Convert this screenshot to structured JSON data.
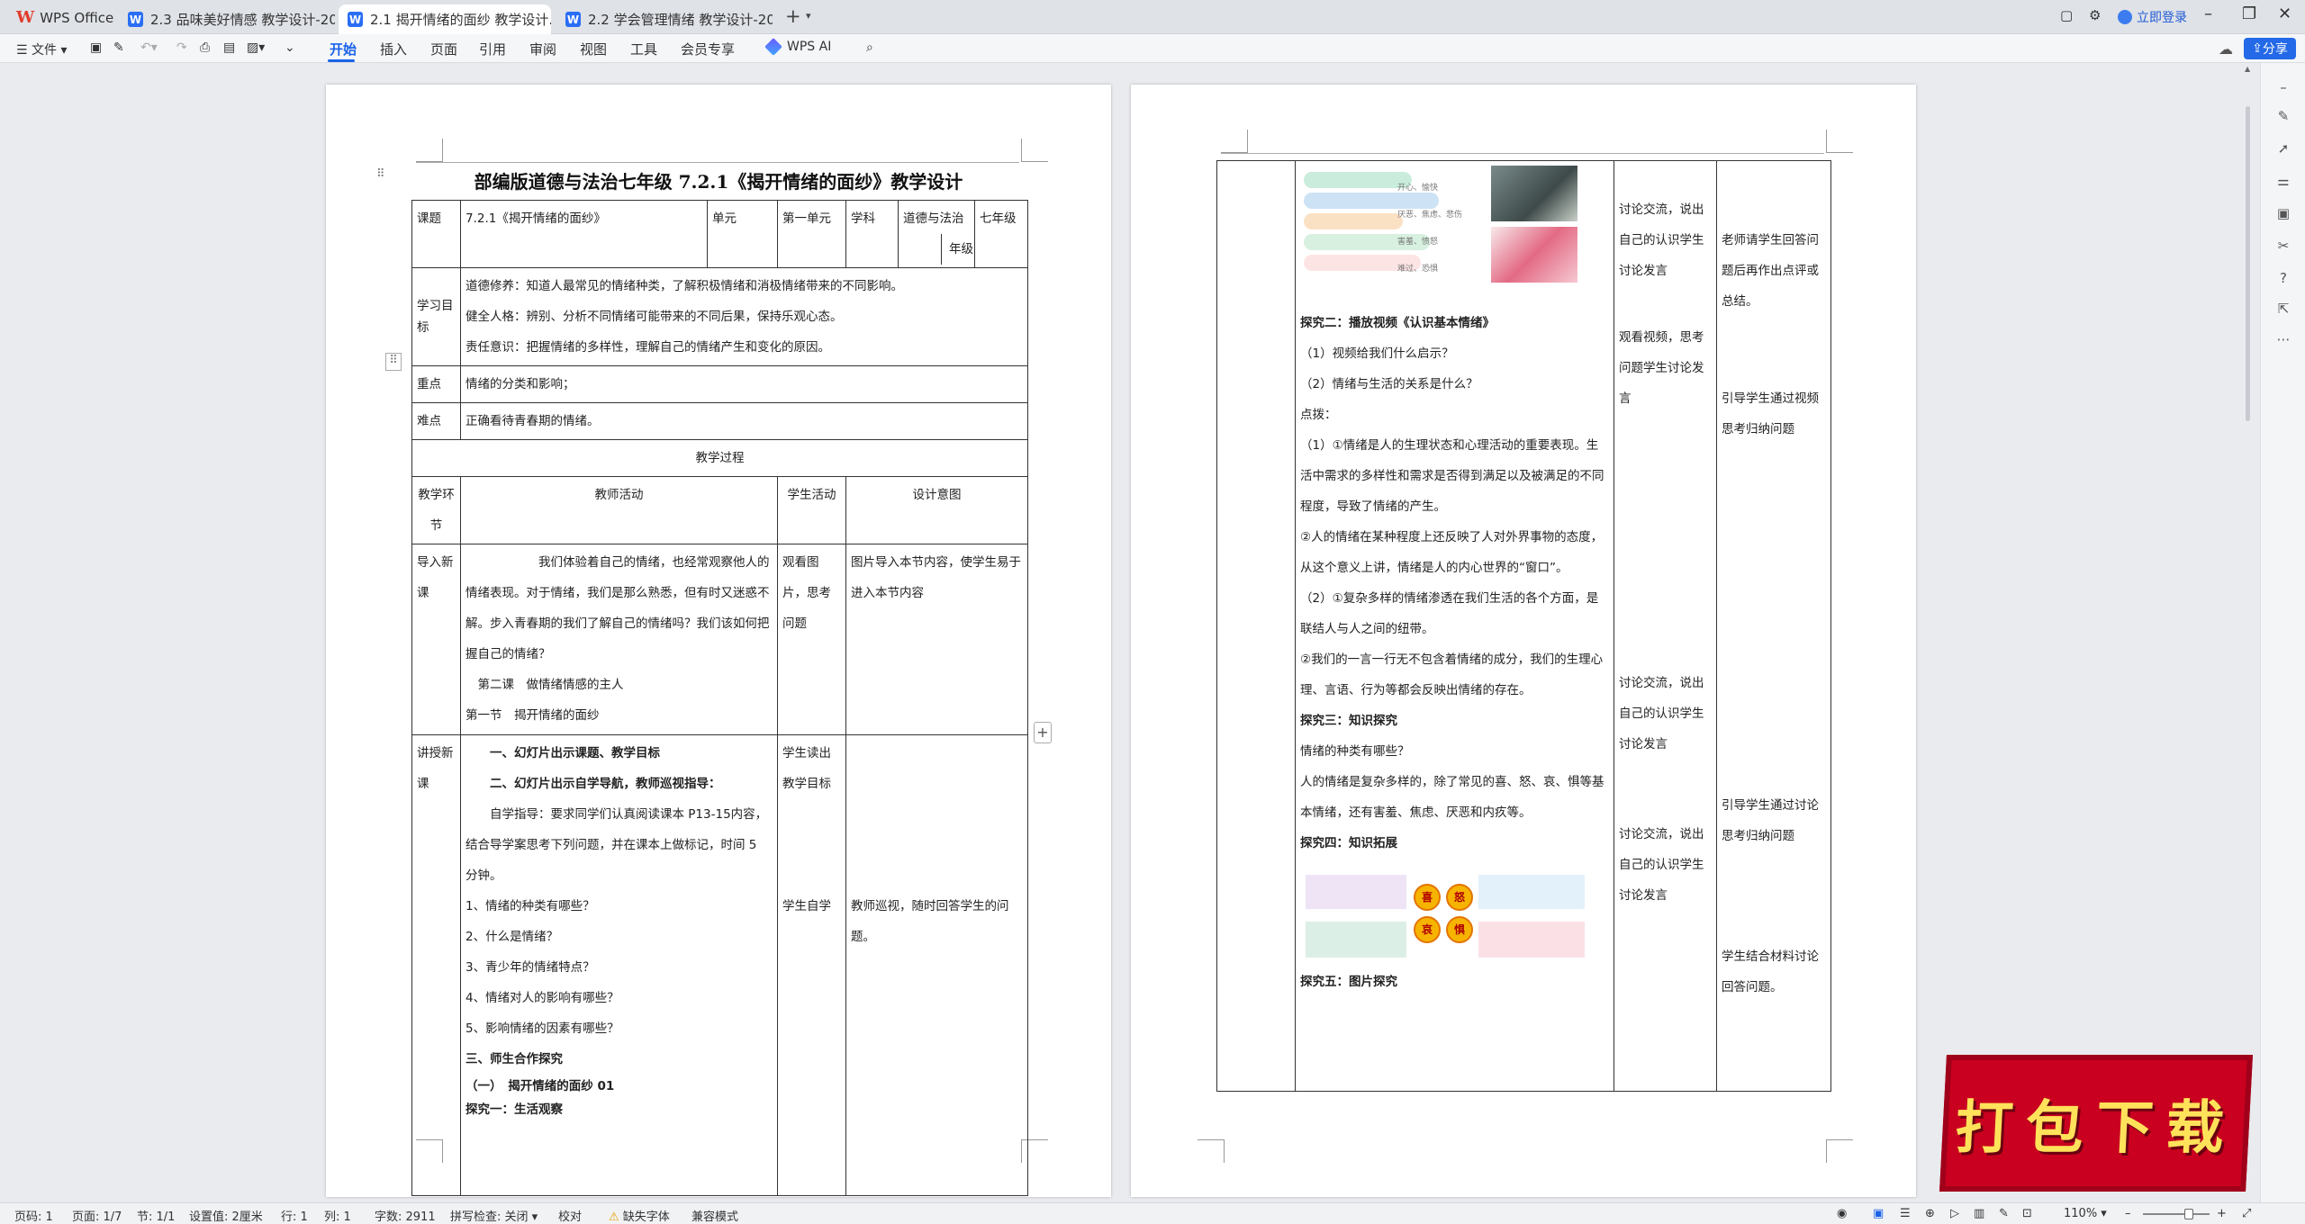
{
  "app": {
    "name": "WPS Office"
  },
  "tabs": [
    {
      "label": "2.3 品味美好情感 教学设计-2024-20..."
    },
    {
      "label": "2.1 揭开情绪的面纱 教学设计..."
    },
    {
      "label": "2.2 学会管理情绪 教学设计-2024-20..."
    }
  ],
  "topbar": {
    "login": "立即登录"
  },
  "toolbar": {
    "file": "文件",
    "menus": [
      "开始",
      "插入",
      "页面",
      "引用",
      "审阅",
      "视图",
      "工具",
      "会员专享"
    ],
    "wps_ai": "WPS AI",
    "share": "分享"
  },
  "doc": {
    "title": "部编版道德与法治七年级 7.2.1《揭开情绪的面纱》教学设计",
    "info": {
      "k1": "课题",
      "v1": "7.2.1《揭开情绪的面纱》",
      "k2": "单元",
      "v2": "第一单元",
      "k3": "学科",
      "v3": "道德与法治",
      "k4": "年级",
      "v4": "七年级"
    },
    "goals_label": "学习目标",
    "goals": [
      "道德修养：知道人最常见的情绪种类，了解积极情绪和消极情绪带来的不同影响。",
      "健全人格：辨别、分析不同情绪可能带来的不同后果，保持乐观心态。",
      "责任意识：把握情绪的多样性，理解自己的情绪产生和变化的原因。"
    ],
    "key_label": "重点",
    "key": "情绪的分类和影响；",
    "diff_label": "难点",
    "diff": "正确看待青春期的情绪。",
    "process_title": "教学过程",
    "headers": [
      "教学环节",
      "教师活动",
      "学生活动",
      "设计意图"
    ],
    "intro": {
      "stage": "导入新课",
      "text": "我们体验着自己的情绪，也经常观察他人的情绪表现。对于情绪，我们是那么熟悉，但有时又迷惑不解。步入青春期的我们了解自己的情绪吗？我们该如何把握自己的情绪？",
      "lesson": "第二课　做情绪情感的主人",
      "section": "第一节　揭开情绪的面纱",
      "student": "观看图片，思考问题",
      "intent": "图片导入本节内容，使学生易于进入本节内容"
    },
    "lecture": {
      "stage": "讲授新课",
      "p1": "一、幻灯片出示课题、教学目标",
      "p2": "二、幻灯片出示自学导航，教师巡视指导：",
      "p3": "自学指导：要求同学们认真阅读课本 P13-15内容，结合导学案思考下列问题，并在课本上做标记，时间 5 分钟。",
      "q1": "1、情绪的种类有哪些？",
      "q2": "2、什么是情绪？",
      "q3": "3、青少年的情绪特点？",
      "q4": "4、情绪对人的影响有哪些？",
      "q5": "5、影响情绪的因素有哪些？",
      "p4": "三、师生合作探究",
      "p5": "（一）　揭开情绪的面纱 01",
      "p6": "探究一：生活观察",
      "s1": "学生读出教学目标",
      "s2": "学生自学",
      "i2": "教师巡视，随时回答学生的问题。"
    },
    "page2": {
      "e2_title": "探究二：播放视频《认识基本情绪》",
      "e2_q1": "（1）视频给我们什么启示？",
      "e2_q2": "（2）情绪与生活的关系是什么？",
      "e2_pt": "点拨：",
      "e2_a1": "（1）①情绪是人的生理状态和心理活动的重要表现。生活中需求的多样性和需求是否得到满足以及被满足的不同程度，导致了情绪的产生。",
      "e2_a2": "②人的情绪在某种程度上还反映了人对外界事物的态度，从这个意义上讲，情绪是人的内心世界的“窗口”。",
      "e2_a3": "（2）①复杂多样的情绪渗透在我们生活的各个方面，是联结人与人之间的纽带。",
      "e2_a4": "②我们的一言一行无不包含着情绪的成分，我们的生理心理、言语、行为等都会反映出情绪的存在。",
      "e3_title": "探究三：知识探究",
      "e3_q": "情绪的种类有哪些？",
      "e3_a": "人的情绪是复杂多样的，除了常见的喜、怒、哀、惧等基本情绪，还有害羞、焦虑、厌恶和内疚等。",
      "e4_title": "探究四：知识拓展",
      "e5_title": "探究五：图片探究",
      "c3_1": "讨论交流，说出自己的认识学生讨论发言",
      "c3_2": "观看视频，思考问题学生讨论发言",
      "c3_3": "讨论交流，说出自己的认识学生讨论发言",
      "c3_4": "讨论交流，说出自己的认识学生讨论发言",
      "c4_1": "老师请学生回答问题后再作出点评或总结。",
      "c4_2": "引导学生通过视频思考归纳问题",
      "c4_3": "引导学生通过讨论思考归纳问题",
      "c4_4": "学生结合材料讨论回答问题。",
      "wheel": [
        "喜",
        "怒",
        "哀",
        "惧"
      ],
      "pill_words": [
        "开心、愉快",
        "厌恶、焦虑、悲伤",
        "害羞、愤怒",
        "难过、恐惧"
      ]
    }
  },
  "status": {
    "page": "页码: 1",
    "pages": "页面: 1/7",
    "section": "节: 1/1",
    "setting": "设置值: 2厘米",
    "row": "行: 1",
    "col": "列: 1",
    "words": "字数: 2911",
    "spell": "拼写检查: 关闭",
    "proof": "校对",
    "font": "缺失字体",
    "compat": "兼容模式",
    "zoom": "110%"
  },
  "banner": "打包下载",
  "colors": {
    "accent": "#1a63e8",
    "banner": "#c9001f"
  }
}
